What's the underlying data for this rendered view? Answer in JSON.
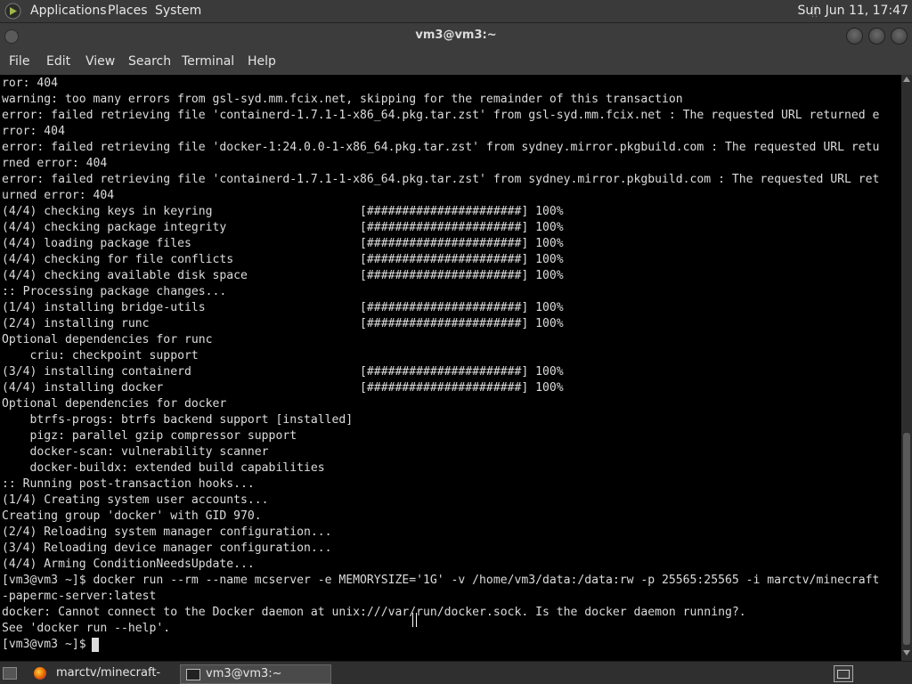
{
  "top_panel": {
    "menus": [
      "Applications",
      "Places",
      "System"
    ],
    "clock": "Sun Jun 11, 17:47"
  },
  "window": {
    "title": "vm3@vm3:~"
  },
  "menubar": [
    "File",
    "Edit",
    "View",
    "Search",
    "Terminal",
    "Help"
  ],
  "terminal": {
    "lines": [
      "ror: 404",
      "warning: too many errors from gsl-syd.mm.fcix.net, skipping for the remainder of this transaction",
      "error: failed retrieving file 'containerd-1.7.1-1-x86_64.pkg.tar.zst' from gsl-syd.mm.fcix.net : The requested URL returned e",
      "rror: 404",
      "error: failed retrieving file 'docker-1:24.0.0-1-x86_64.pkg.tar.zst' from sydney.mirror.pkgbuild.com : The requested URL retu",
      "rned error: 404",
      "error: failed retrieving file 'containerd-1.7.1-1-x86_64.pkg.tar.zst' from sydney.mirror.pkgbuild.com : The requested URL ret",
      "urned error: 404",
      "(4/4) checking keys in keyring                     [######################] 100%",
      "(4/4) checking package integrity                   [######################] 100%",
      "(4/4) loading package files                        [######################] 100%",
      "(4/4) checking for file conflicts                  [######################] 100%",
      "(4/4) checking available disk space                [######################] 100%",
      ":: Processing package changes...",
      "(1/4) installing bridge-utils                      [######################] 100%",
      "(2/4) installing runc                              [######################] 100%",
      "Optional dependencies for runc",
      "    criu: checkpoint support",
      "(3/4) installing containerd                        [######################] 100%",
      "(4/4) installing docker                            [######################] 100%",
      "Optional dependencies for docker",
      "    btrfs-progs: btrfs backend support [installed]",
      "    pigz: parallel gzip compressor support",
      "    docker-scan: vulnerability scanner",
      "    docker-buildx: extended build capabilities",
      ":: Running post-transaction hooks...",
      "(1/4) Creating system user accounts...",
      "Creating group 'docker' with GID 970.",
      "(2/4) Reloading system manager configuration...",
      "(3/4) Reloading device manager configuration...",
      "(4/4) Arming ConditionNeedsUpdate...",
      "[vm3@vm3 ~]$ docker run --rm --name mcserver -e MEMORYSIZE='1G' -v /home/vm3/data:/data:rw -p 25565:25565 -i marctv/minecraft",
      "-papermc-server:latest",
      "docker: Cannot connect to the Docker daemon at unix:///var/run/docker.sock. Is the docker daemon running?.",
      "See 'docker run --help'.",
      "[vm3@vm3 ~]$ "
    ]
  },
  "taskbar": {
    "tasks": [
      {
        "label": "marctv/minecraft-p...",
        "icon": "firefox-icon"
      },
      {
        "label": "vm3@vm3:~",
        "icon": "terminal-icon"
      }
    ]
  },
  "colors": {
    "panel_bg": "#3a3a3a",
    "terminal_bg": "#000000",
    "terminal_fg": "#dcdcdc"
  }
}
